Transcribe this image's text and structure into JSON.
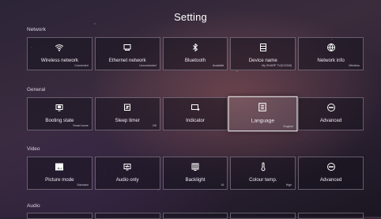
{
  "title": "Setting",
  "sections": {
    "network": {
      "label": "Network",
      "tiles": [
        {
          "label": "Wireless network",
          "status": "Connected",
          "icon": "wifi-icon"
        },
        {
          "label": "Ethernet network",
          "status": "Unconnected",
          "icon": "ethernet-icon"
        },
        {
          "label": "Bluetooth",
          "status": "Available",
          "icon": "bluetooth-icon"
        },
        {
          "label": "Device name",
          "status": "My SHARP TV(012345)",
          "icon": "device-name-icon"
        },
        {
          "label": "Network info",
          "status": "Wireless",
          "icon": "globe-icon"
        }
      ]
    },
    "general": {
      "label": "General",
      "tiles": [
        {
          "label": "Booting state",
          "status": "Smart home",
          "icon": "tv-icon"
        },
        {
          "label": "Sleep timer",
          "status": "Off",
          "icon": "sleep-timer-icon"
        },
        {
          "label": "Indicator",
          "status": "",
          "icon": "indicator-icon"
        },
        {
          "label": "Language",
          "status": "English",
          "icon": "language-icon"
        },
        {
          "label": "Advanced",
          "status": "",
          "icon": "more-icon"
        }
      ]
    },
    "video": {
      "label": "Video",
      "tiles": [
        {
          "label": "Picture mode",
          "status": "Standard",
          "icon": "picture-icon"
        },
        {
          "label": "Audio only",
          "status": "",
          "icon": "audio-only-icon"
        },
        {
          "label": "Backlight",
          "status": "16",
          "icon": "backlight-icon"
        },
        {
          "label": "Colour temp.",
          "status": "High",
          "icon": "thermometer-icon"
        },
        {
          "label": "Advanced",
          "status": "",
          "icon": "more-icon"
        }
      ]
    },
    "audio": {
      "label": "Audio"
    }
  },
  "selected": "Language"
}
